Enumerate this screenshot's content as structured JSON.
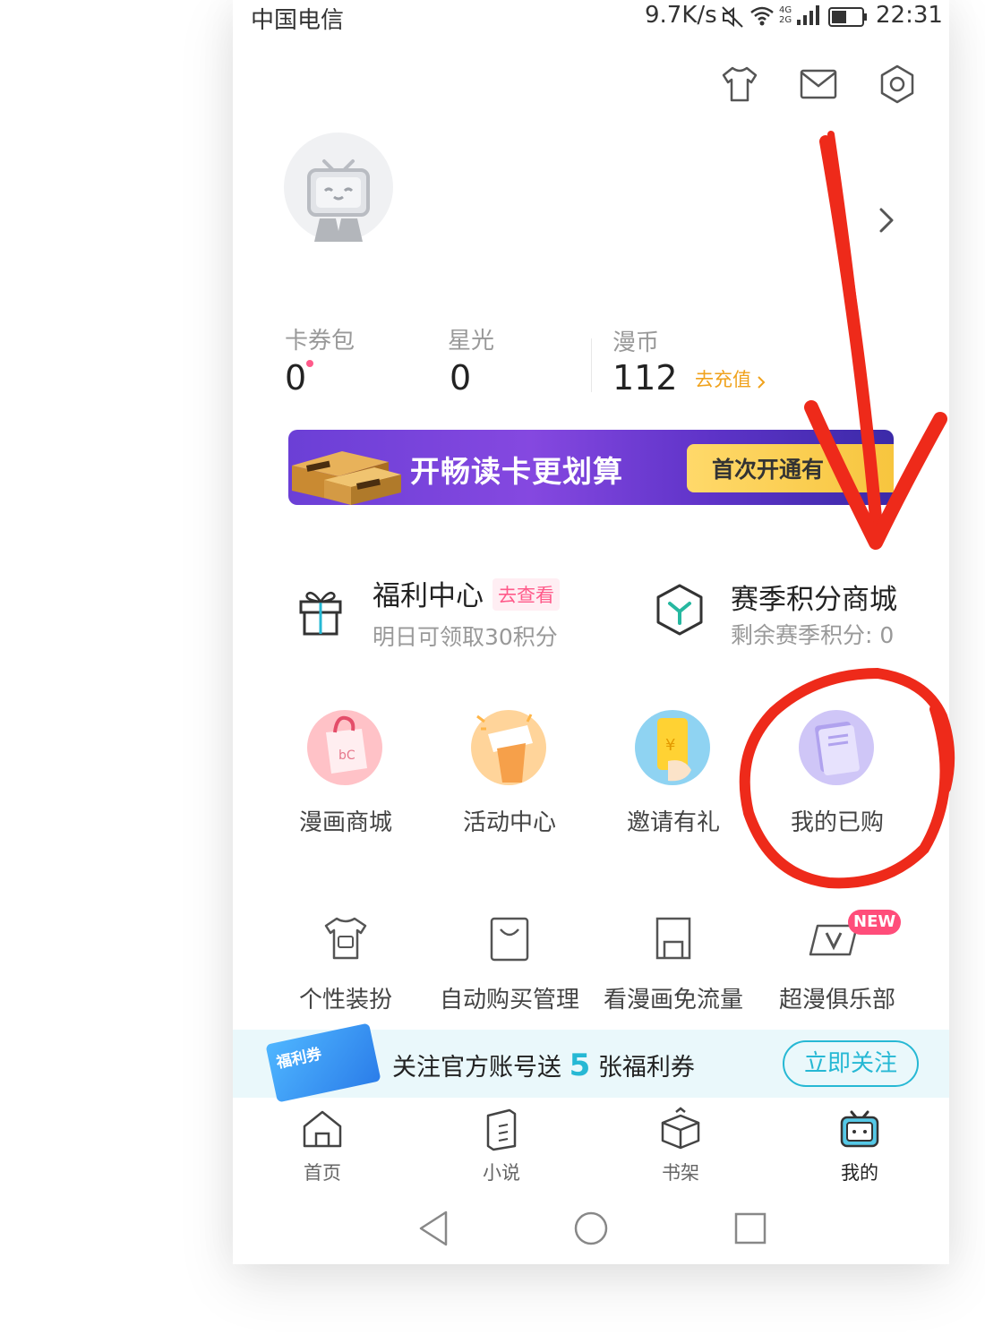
{
  "status_bar": {
    "carrier": "中国电信",
    "network_speed": "9.7K/s",
    "signal_label": "4G 2G",
    "time": "22:31"
  },
  "header_icons": [
    "tshirt-icon",
    "mail-icon",
    "settings-hex-icon"
  ],
  "stats": {
    "coupons": {
      "label": "卡券包",
      "value": "0"
    },
    "starlight": {
      "label": "星光",
      "value": "0"
    },
    "coins": {
      "label": "漫币",
      "value": "112",
      "action": "去充值"
    }
  },
  "banner": {
    "title": "开畅读卡更划算",
    "cta": "首次开通有"
  },
  "features": {
    "welfare": {
      "title": "福利中心",
      "tag": "去查看",
      "subtitle": "明日可领取30积分"
    },
    "season_shop": {
      "title": "赛季积分商城",
      "subtitle": "剩余赛季积分: 0"
    }
  },
  "grid_row1": [
    {
      "label": "漫画商城",
      "icon": "shopping-bag-icon"
    },
    {
      "label": "活动中心",
      "icon": "activity-icon"
    },
    {
      "label": "邀请有礼",
      "icon": "invite-gift-icon"
    },
    {
      "label": "我的已购",
      "icon": "purchased-book-icon"
    }
  ],
  "grid_row2": [
    {
      "label": "个性装扮",
      "icon": "outfit-icon"
    },
    {
      "label": "自动购买管理",
      "icon": "auto-buy-icon"
    },
    {
      "label": "看漫画免流量",
      "icon": "free-data-icon"
    },
    {
      "label": "超漫俱乐部",
      "icon": "vip-club-icon",
      "badge": "NEW"
    }
  ],
  "follow_bar": {
    "prefix": "关注官方账号送",
    "number": "5",
    "suffix": "张福利券",
    "button": "立即关注",
    "ticket_text": "福利券"
  },
  "bottom_nav": [
    {
      "label": "首页",
      "icon": "home-icon",
      "active": false
    },
    {
      "label": "小说",
      "icon": "novel-icon",
      "active": false
    },
    {
      "label": "书架",
      "icon": "bookshelf-icon",
      "active": false
    },
    {
      "label": "我的",
      "icon": "mine-tv-icon",
      "active": true
    }
  ],
  "colors": {
    "accent": "#26b8d4",
    "recharge": "#f0a21c",
    "tag_pink": "#ff5a8a",
    "annotation_red": "#ee2a1a"
  }
}
